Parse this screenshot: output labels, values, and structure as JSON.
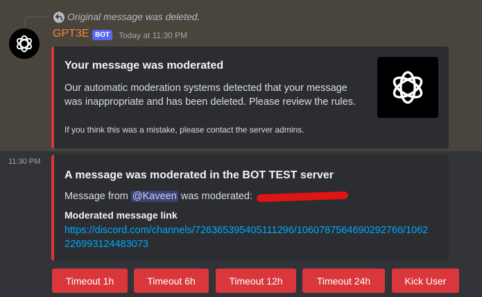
{
  "reply": {
    "text": "Original message was deleted.",
    "icon": "reply-arrow-icon"
  },
  "message": {
    "author": "GPT3E",
    "bot_tag": "BOT",
    "timestamp": "Today at 11:30 PM",
    "avatar_icon": "openai-logo-icon"
  },
  "embed1": {
    "title": "Your message was moderated",
    "description_line1": "Our automatic moderation systems detected that your message",
    "description_line2": "was inappropriate and has been deleted. Please review the rules.",
    "footer": "If you think this was a mistake, please contact the server admins.",
    "thumbnail_icon": "openai-logo-icon",
    "accent_color": "#da373c"
  },
  "followup": {
    "timestamp": "11:30 PM"
  },
  "embed2": {
    "title": "A message was moderated in the BOT TEST server",
    "desc_prefix": "Message from",
    "mention": "@Kaveen",
    "desc_suffix": "was moderated:",
    "field_name": "Moderated message link",
    "link_line1": "https://discord.com/channels/726365395405111296/1060787564690292766/1062",
    "link_line2": "226993124483073",
    "accent_color": "#da373c"
  },
  "buttons": [
    {
      "label": "Timeout 1h"
    },
    {
      "label": "Timeout 6h"
    },
    {
      "label": "Timeout 12h"
    },
    {
      "label": "Timeout 24h"
    },
    {
      "label": "Kick User"
    }
  ],
  "colors": {
    "danger": "#da373c",
    "link": "#00a8fc",
    "username": "#f0883e",
    "bot_tag": "#5865f2"
  }
}
